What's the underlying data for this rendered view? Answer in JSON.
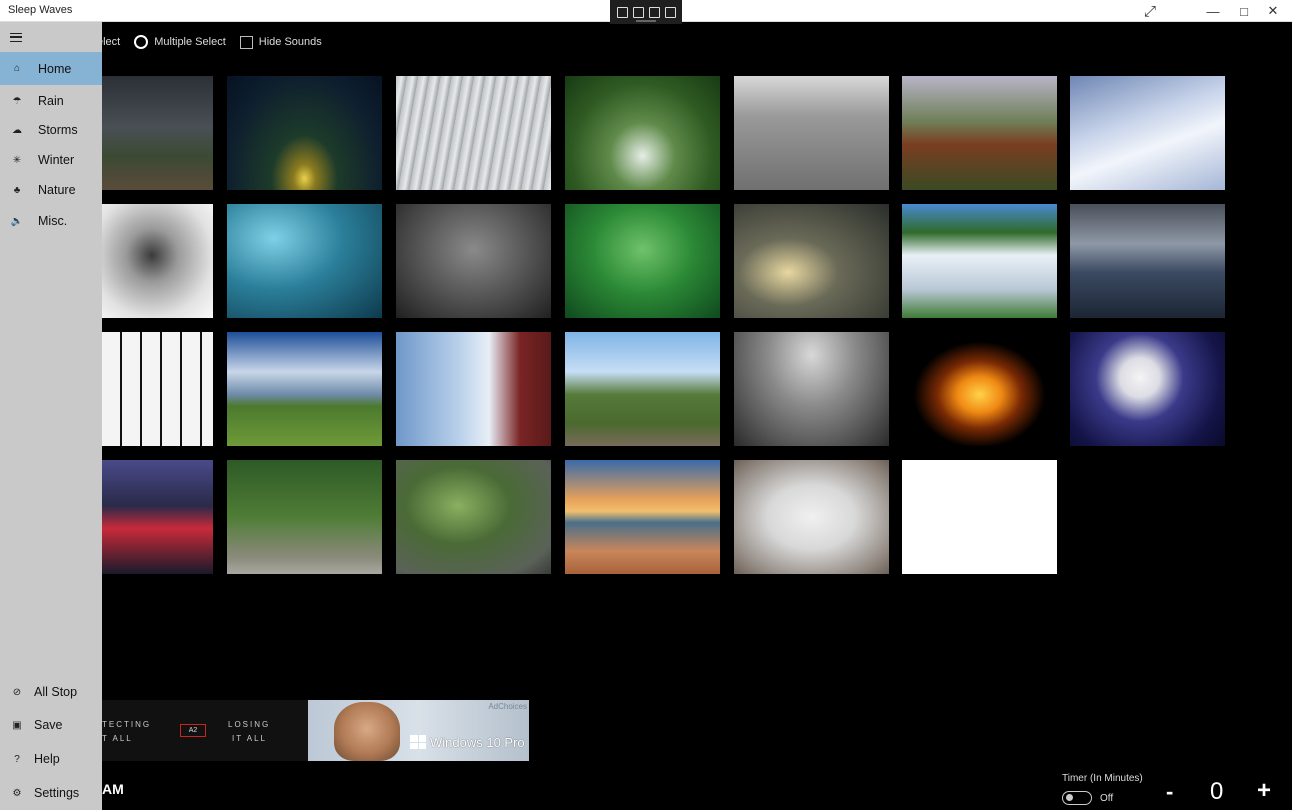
{
  "titlebar": {
    "title": "Sleep Waves",
    "resize_icon": "diagonal-arrows-icon",
    "minimize_icon": "minimize-icon",
    "maximize_icon": "maximize-icon",
    "close_icon": "close-icon"
  },
  "options": {
    "single_select": "Single Select",
    "multiple_select": "Multiple Select",
    "hide_sounds": "Hide Sounds"
  },
  "sidebar": {
    "menu_icon": "hamburger-icon",
    "items": [
      {
        "label": "Home",
        "icon": "home-icon",
        "glyph": "⌂"
      },
      {
        "label": "Rain",
        "icon": "rain-cloud-icon",
        "glyph": "☂"
      },
      {
        "label": "Storms",
        "icon": "storm-cloud-icon",
        "glyph": "☁"
      },
      {
        "label": "Winter",
        "icon": "snowflake-icon",
        "glyph": "✳"
      },
      {
        "label": "Nature",
        "icon": "leaf-icon",
        "glyph": "♣"
      },
      {
        "label": "Misc.",
        "icon": "speaker-icon",
        "glyph": "🔈"
      }
    ],
    "bottom_items": [
      {
        "label": "All Stop",
        "icon": "stop-icon",
        "glyph": "⊘"
      },
      {
        "label": "Save",
        "icon": "save-icon",
        "glyph": "▣"
      },
      {
        "label": "Help",
        "icon": "help-icon",
        "glyph": "?"
      },
      {
        "label": "Settings",
        "icon": "settings-icon",
        "glyph": "⚙"
      }
    ]
  },
  "tiles": [
    "dark-field-storm",
    "night-tent-camping",
    "metal-roof-rain",
    "forest-stream",
    "gravel-road",
    "mountain-cabin",
    "snowy-mountain",
    "bare-tree-snow",
    "wind-chimes",
    "rain-puddle",
    "jungle-ferns",
    "rain-window",
    "waterfall",
    "dock-storm",
    "piano-keys",
    "grassland-clouds",
    "nursery-crib",
    "steam-train",
    "airplane-cabin",
    "fire",
    "oscillating-fan",
    "city-night",
    "forest-path",
    "leaves-wall",
    "beach-sunset",
    "box-fan",
    "blank-white"
  ],
  "ad": {
    "adchoices": "AdChoices",
    "left_text_1": "TECTING",
    "left_text_2": "T ALL",
    "left_text_3": "LOSING",
    "left_text_4": "IT ALL",
    "logo": "A2",
    "windows_text": "Windows 10 Pro"
  },
  "bottom": {
    "clock": "AM",
    "timer_label": "Timer (In Minutes)",
    "toggle_label": "Off",
    "minus": "-",
    "timer_value": "0",
    "plus": "+"
  }
}
